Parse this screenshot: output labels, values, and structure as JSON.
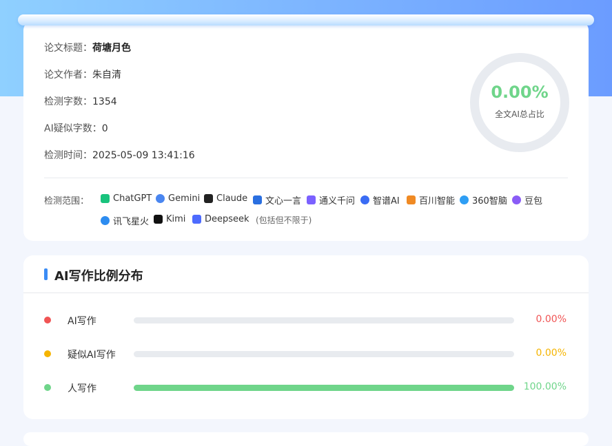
{
  "report": {
    "title_label": "论文标题：",
    "title_value": "荷塘月色",
    "author_label": "论文作者：",
    "author_value": "朱自清",
    "wordcount_label": "检测字数：",
    "wordcount_value": "1354",
    "ai_count_label": "AI疑似字数：",
    "ai_count_value": "0",
    "time_label": "检测时间：",
    "time_value": "2025-05-09 13:41:16"
  },
  "summary": {
    "percent": "0.00%",
    "percent_value": 0.0,
    "caption": "全文AI总占比"
  },
  "scope": {
    "label": "检测范围：",
    "models": [
      {
        "name": "ChatGPT",
        "icon": "chatgpt-icon",
        "color": "#19c37d"
      },
      {
        "name": "Gemini",
        "icon": "gemini-icon",
        "color": "#4a86f0"
      },
      {
        "name": "Claude",
        "icon": "claude-icon",
        "color": "#222222"
      },
      {
        "name": "文心一言",
        "icon": "wenxin-icon",
        "color": "#2a6fe0"
      },
      {
        "name": "通义千问",
        "icon": "tongyi-icon",
        "color": "#7b61ff"
      },
      {
        "name": "智谱AI",
        "icon": "zhipu-icon",
        "color": "#3a6cf4"
      },
      {
        "name": "百川智能",
        "icon": "baichuan-icon",
        "color": "#f08a24"
      },
      {
        "name": "360智脑",
        "icon": "360-icon",
        "color": "#2e9ef4"
      },
      {
        "name": "豆包",
        "icon": "doubao-icon",
        "color": "#8a5cf6"
      },
      {
        "name": "讯飞星火",
        "icon": "xunfei-icon",
        "color": "#2d8cf0"
      },
      {
        "name": "Kimi",
        "icon": "kimi-icon",
        "color": "#111111"
      },
      {
        "name": "Deepseek",
        "icon": "deepseek-icon",
        "color": "#4d6bfe"
      }
    ],
    "note": "(包括但不限于)"
  },
  "distribution": {
    "title": "AI写作比例分布",
    "rows": [
      {
        "label": "AI写作",
        "percent": "0.00%",
        "value": 0.0,
        "color": "#f05454"
      },
      {
        "label": "疑似AI写作",
        "percent": "0.00%",
        "value": 0.0,
        "color": "#f5b400"
      },
      {
        "label": "人写作",
        "percent": "100.00%",
        "value": 1.0,
        "color": "#6fd58a"
      }
    ]
  }
}
